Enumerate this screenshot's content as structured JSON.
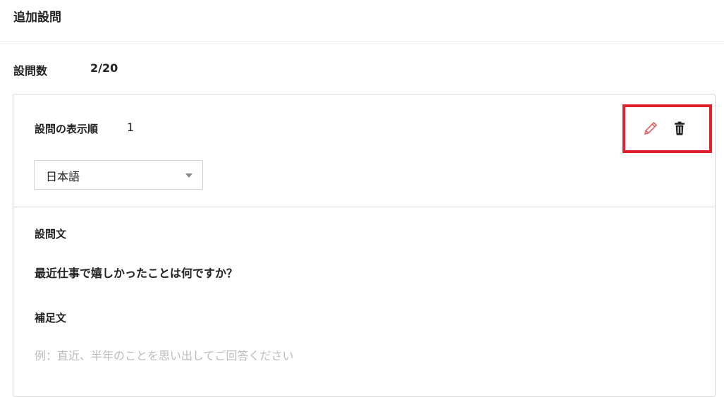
{
  "header": {
    "title": "追加設問"
  },
  "summary": {
    "count_label": "設問数",
    "count_value": "2/20"
  },
  "question": {
    "order_label": "設問の表示順",
    "order_value": "1",
    "language": {
      "selected": "日本語"
    },
    "actions": {
      "edit_icon": "pencil-icon",
      "edit_color": "#e06b6b",
      "delete_icon": "trash-icon",
      "delete_color": "#222222"
    },
    "text_label": "設問文",
    "text_value": "最近仕事で嬉しかったことは何ですか？",
    "supplement_label": "補足文",
    "supplement_placeholder": "例：直近、半年のことを思い出してご回答ください"
  },
  "highlight": {
    "color": "#e0202a"
  }
}
